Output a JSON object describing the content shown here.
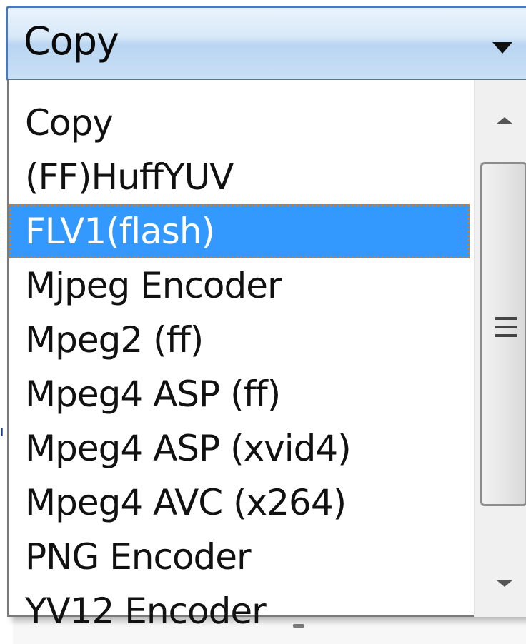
{
  "combo": {
    "selected_value": "Copy"
  },
  "dropdown": {
    "items": [
      "Copy",
      "(FF)HuffYUV",
      "FLV1(flash)",
      "Mjpeg Encoder",
      "Mpeg2 (ff)",
      "Mpeg4 ASP (ff)",
      "Mpeg4 ASP (xvid4)",
      "Mpeg4 AVC (x264)",
      "PNG Encoder",
      "YV12 Encoder"
    ],
    "highlighted_item": "FLV1(flash)"
  },
  "colors": {
    "selection": "#3399ff",
    "focus_outline": "#d9791f",
    "combo_border": "#4a78b8"
  },
  "icons": {
    "combo_arrow": "chevron-down-icon",
    "scroll_up": "scroll-up-arrow-icon",
    "scroll_down": "scroll-down-arrow-icon",
    "thumb_grip": "grip-icon"
  }
}
